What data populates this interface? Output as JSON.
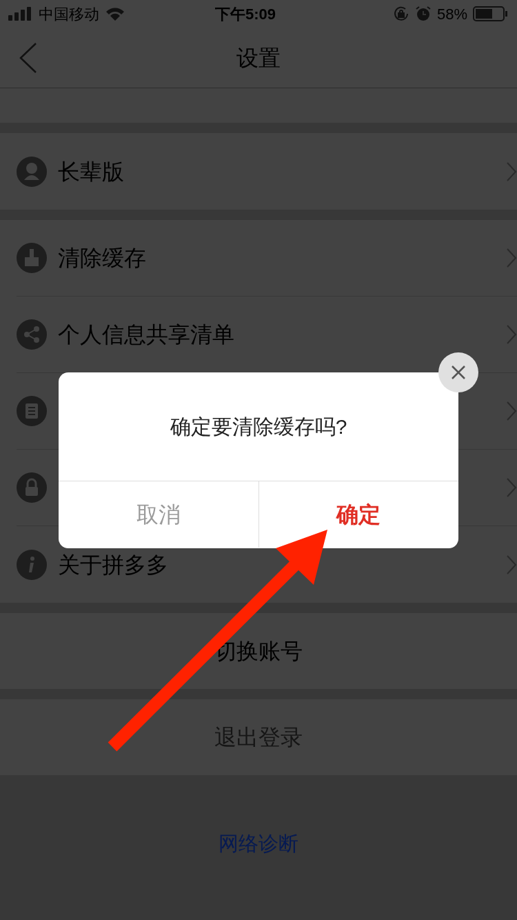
{
  "status_bar": {
    "carrier": "中国移动",
    "time": "下午5:09",
    "battery": "58%"
  },
  "nav": {
    "title": "设置"
  },
  "sections": [
    {
      "items": [
        {
          "kind": "elder",
          "label": "长辈版"
        }
      ]
    },
    {
      "items": [
        {
          "kind": "broom",
          "label": "清除缓存"
        },
        {
          "kind": "share",
          "label": "个人信息共享清单"
        },
        {
          "kind": "list"
        },
        {
          "kind": "lock"
        },
        {
          "kind": "info",
          "label": "关于拼多多"
        }
      ]
    }
  ],
  "actions": [
    {
      "label": "切换账号",
      "kind": "dark"
    },
    {
      "label": "退出登录",
      "kind": "muted"
    }
  ],
  "link": "网络诊断",
  "dialog": {
    "message": "确定要清除缓存吗?",
    "buttons": [
      {
        "label": "取消",
        "kind": "cancel"
      },
      {
        "label": "确定",
        "kind": "confirm"
      }
    ]
  }
}
